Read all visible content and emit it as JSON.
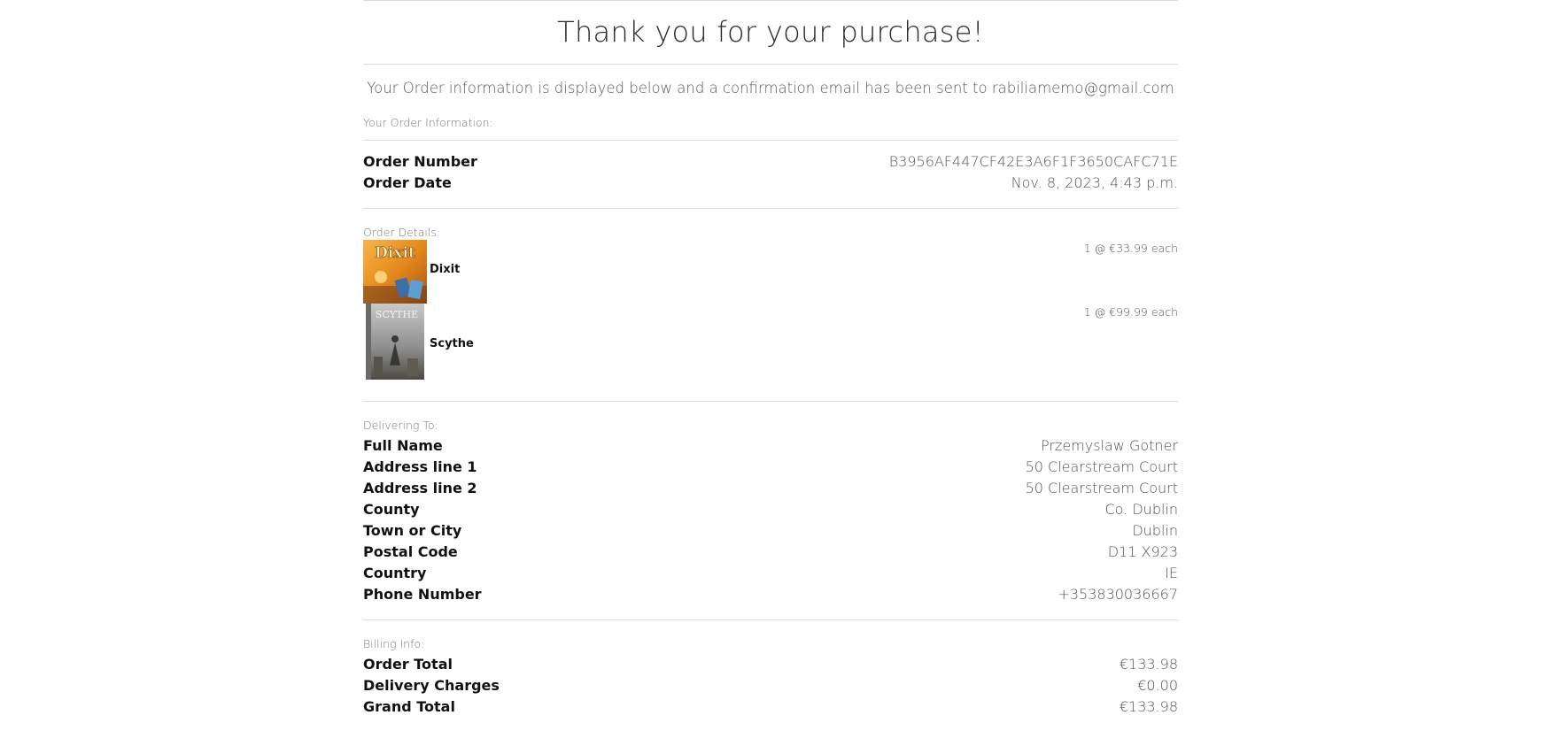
{
  "page": {
    "title": "Thank you for your purchase!",
    "confirmation_message": "Your Order information is displayed below and a confirmation email has been sent to rabiliamemo@gmail.com"
  },
  "order_info": {
    "label": "Your Order Information:",
    "rows": [
      {
        "label": "Order Number",
        "value": "B3956AF447CF42E3A6F1F3650CAFC71E"
      },
      {
        "label": "Order Date",
        "value": "Nov. 8, 2023, 4:43 p.m."
      }
    ]
  },
  "order_details": {
    "label": "Order Details:",
    "items": [
      {
        "name": "Dixit",
        "price_text": "1 @ €33.99 each",
        "image_icon": "dixit-box-image",
        "box_text": "Dixit"
      },
      {
        "name": "Scythe",
        "price_text": "1 @ €99.99 each",
        "image_icon": "scythe-box-image",
        "box_text": "SCYTHE"
      }
    ]
  },
  "delivery": {
    "label": "Delivering To:",
    "rows": [
      {
        "label": "Full Name",
        "value": "Przemyslaw Gotner"
      },
      {
        "label": "Address line 1",
        "value": "50 Clearstream Court"
      },
      {
        "label": "Address line 2",
        "value": "50 Clearstream Court"
      },
      {
        "label": "County",
        "value": "Co. Dublin"
      },
      {
        "label": "Town or City",
        "value": "Dublin"
      },
      {
        "label": "Postal Code",
        "value": "D11 X923"
      },
      {
        "label": "Country",
        "value": "IE"
      },
      {
        "label": "Phone Number",
        "value": "+353830036667"
      }
    ]
  },
  "billing": {
    "label": "Billing Info:",
    "rows": [
      {
        "label": "Order Total",
        "value": "€133.98"
      },
      {
        "label": "Delivery Charges",
        "value": "€0.00"
      },
      {
        "label": "Grand Total",
        "value": "€133.98"
      }
    ]
  },
  "colors": {
    "rule": "#dedede",
    "label_text": "#111111",
    "value_text": "#555555"
  }
}
